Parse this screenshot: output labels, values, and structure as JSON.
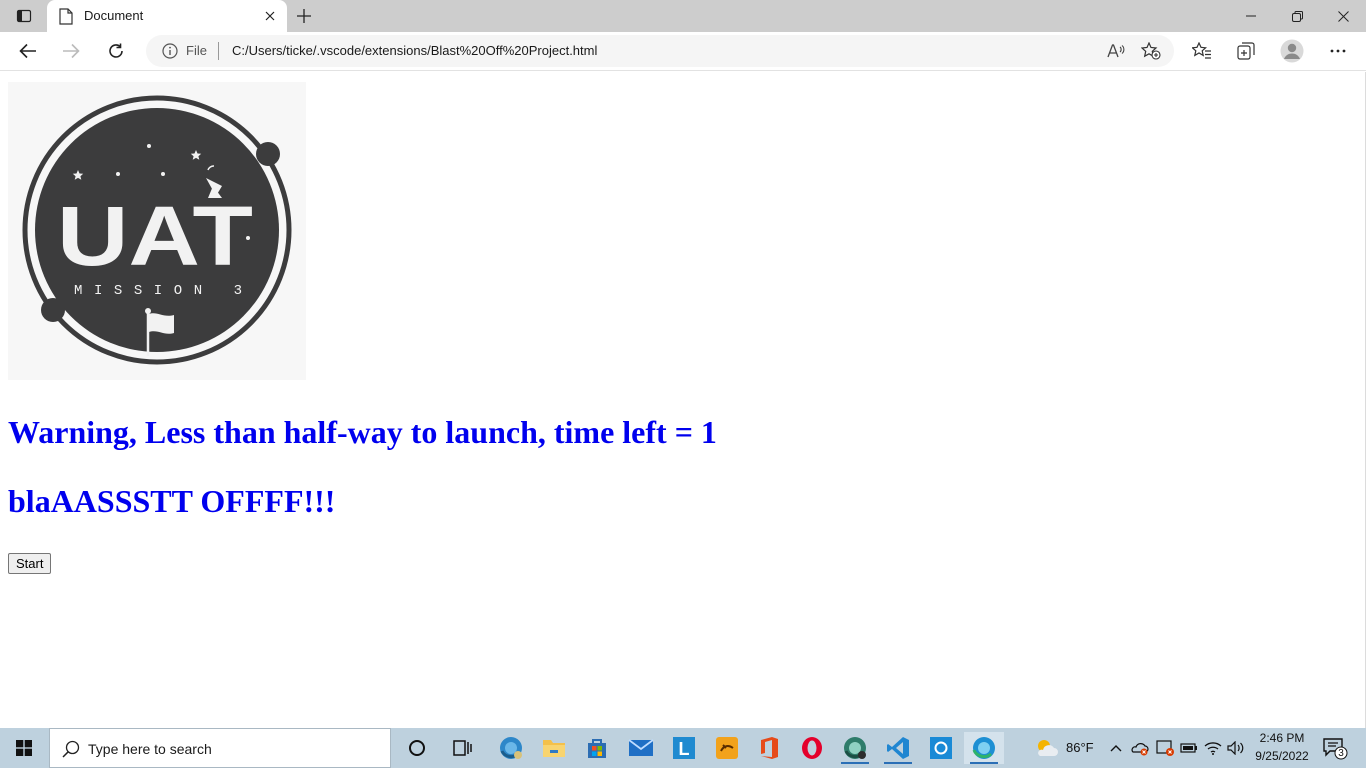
{
  "browser": {
    "tab_title": "Document",
    "address_scheme": "File",
    "address_url": "C:/Users/ticke/.vscode/extensions/Blast%20Off%20Project.html",
    "accent": "#0078d4"
  },
  "page": {
    "logo": {
      "title": "UAT",
      "subtitle": "MISSION 3"
    },
    "warning_heading": "Warning, Less than half-way to launch, time left = 1",
    "blast_heading": "blaAASSSTT OFFFF!!!",
    "start_button": "Start",
    "heading_color": "#0000ee"
  },
  "taskbar": {
    "search_placeholder": "Type here to search",
    "apps": [
      "cortana-icon",
      "task-view-icon",
      "edge-beta-icon",
      "file-explorer-icon",
      "microsoft-store-icon",
      "mail-icon",
      "lumin-icon",
      "photo-app-icon",
      "office-icon",
      "opera-icon",
      "edge-dev-icon",
      "vscode-icon",
      "cortana-blue-icon",
      "edge-icon"
    ],
    "weather_temp": "86°F",
    "time": "2:46 PM",
    "date": "9/25/2022",
    "notifications_count": "3"
  }
}
